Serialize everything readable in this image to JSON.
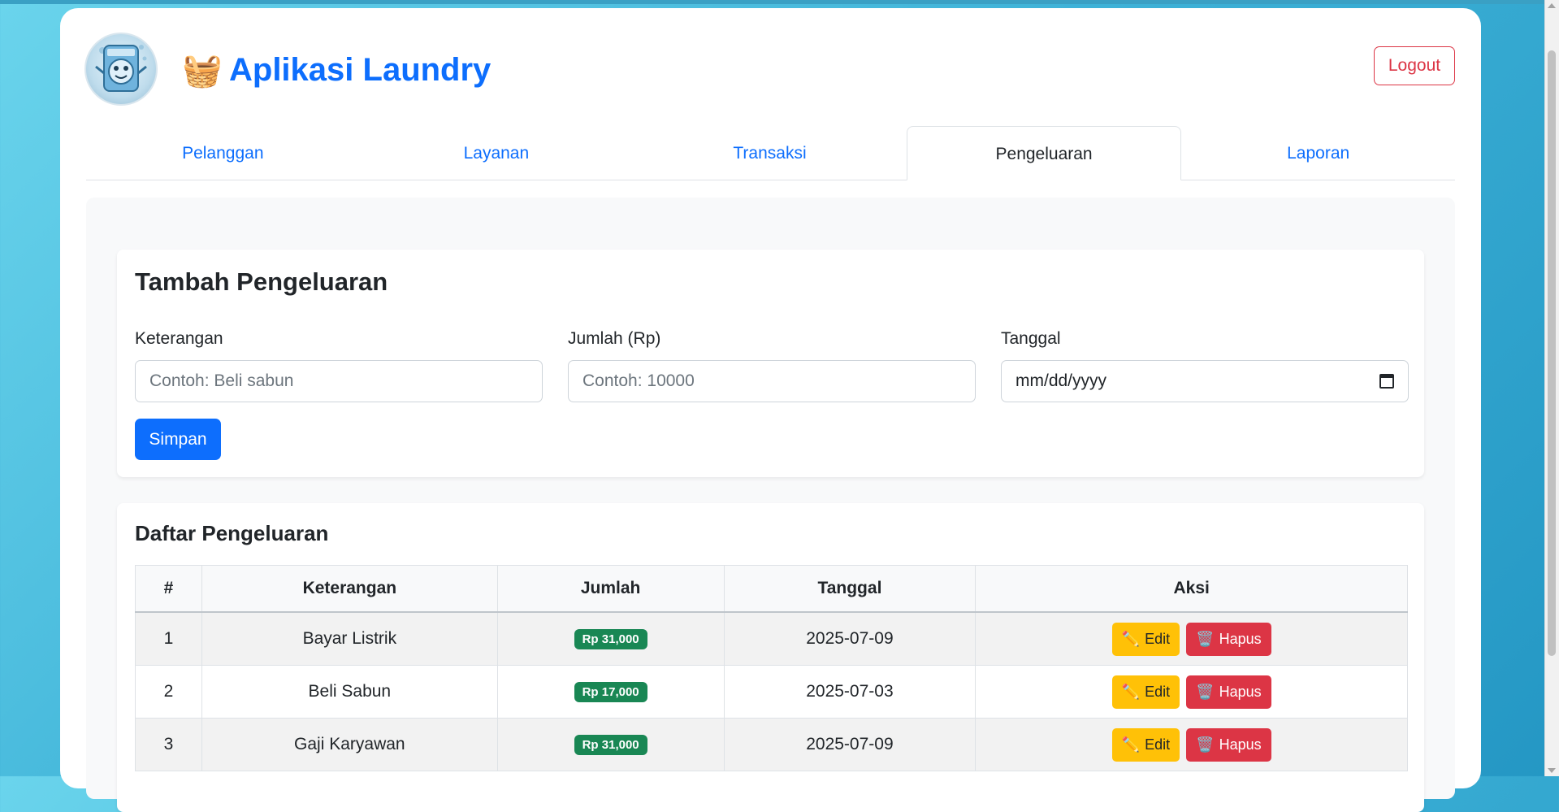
{
  "app": {
    "title": "Aplikasi Laundry",
    "title_icon": "basket-icon",
    "basket_glyph": "🧺",
    "logout_label": "Logout",
    "accent_color": "#0d6efd"
  },
  "tabs": [
    {
      "label": "Pelanggan",
      "active": false
    },
    {
      "label": "Layanan",
      "active": false
    },
    {
      "label": "Transaksi",
      "active": false
    },
    {
      "label": "Pengeluaran",
      "active": true
    },
    {
      "label": "Laporan",
      "active": false
    }
  ],
  "form": {
    "title": "Tambah Pengeluaran",
    "keterangan": {
      "label": "Keterangan",
      "placeholder": "Contoh: Beli sabun",
      "value": ""
    },
    "jumlah": {
      "label": "Jumlah (Rp)",
      "placeholder": "Contoh: 10000",
      "value": ""
    },
    "tanggal": {
      "label": "Tanggal",
      "value": "mm/dd/yyyy"
    },
    "save_label": "Simpan"
  },
  "list": {
    "title": "Daftar Pengeluaran",
    "columns": [
      "#",
      "Keterangan",
      "Jumlah",
      "Tanggal",
      "Aksi"
    ],
    "rows": [
      {
        "no": "1",
        "keterangan": "Bayar Listrik",
        "jumlah": "Rp 31,000",
        "tanggal": "2025-07-09"
      },
      {
        "no": "2",
        "keterangan": "Beli Sabun",
        "jumlah": "Rp 17,000",
        "tanggal": "2025-07-03"
      },
      {
        "no": "3",
        "keterangan": "Gaji Karyawan",
        "jumlah": "Rp 31,000",
        "tanggal": "2025-07-09"
      }
    ],
    "edit_label": "Edit",
    "delete_label": "Hapus",
    "edit_icon": "pencil-icon",
    "delete_icon": "trash-icon",
    "edit_glyph": "✏️",
    "delete_glyph": "🗑️"
  }
}
